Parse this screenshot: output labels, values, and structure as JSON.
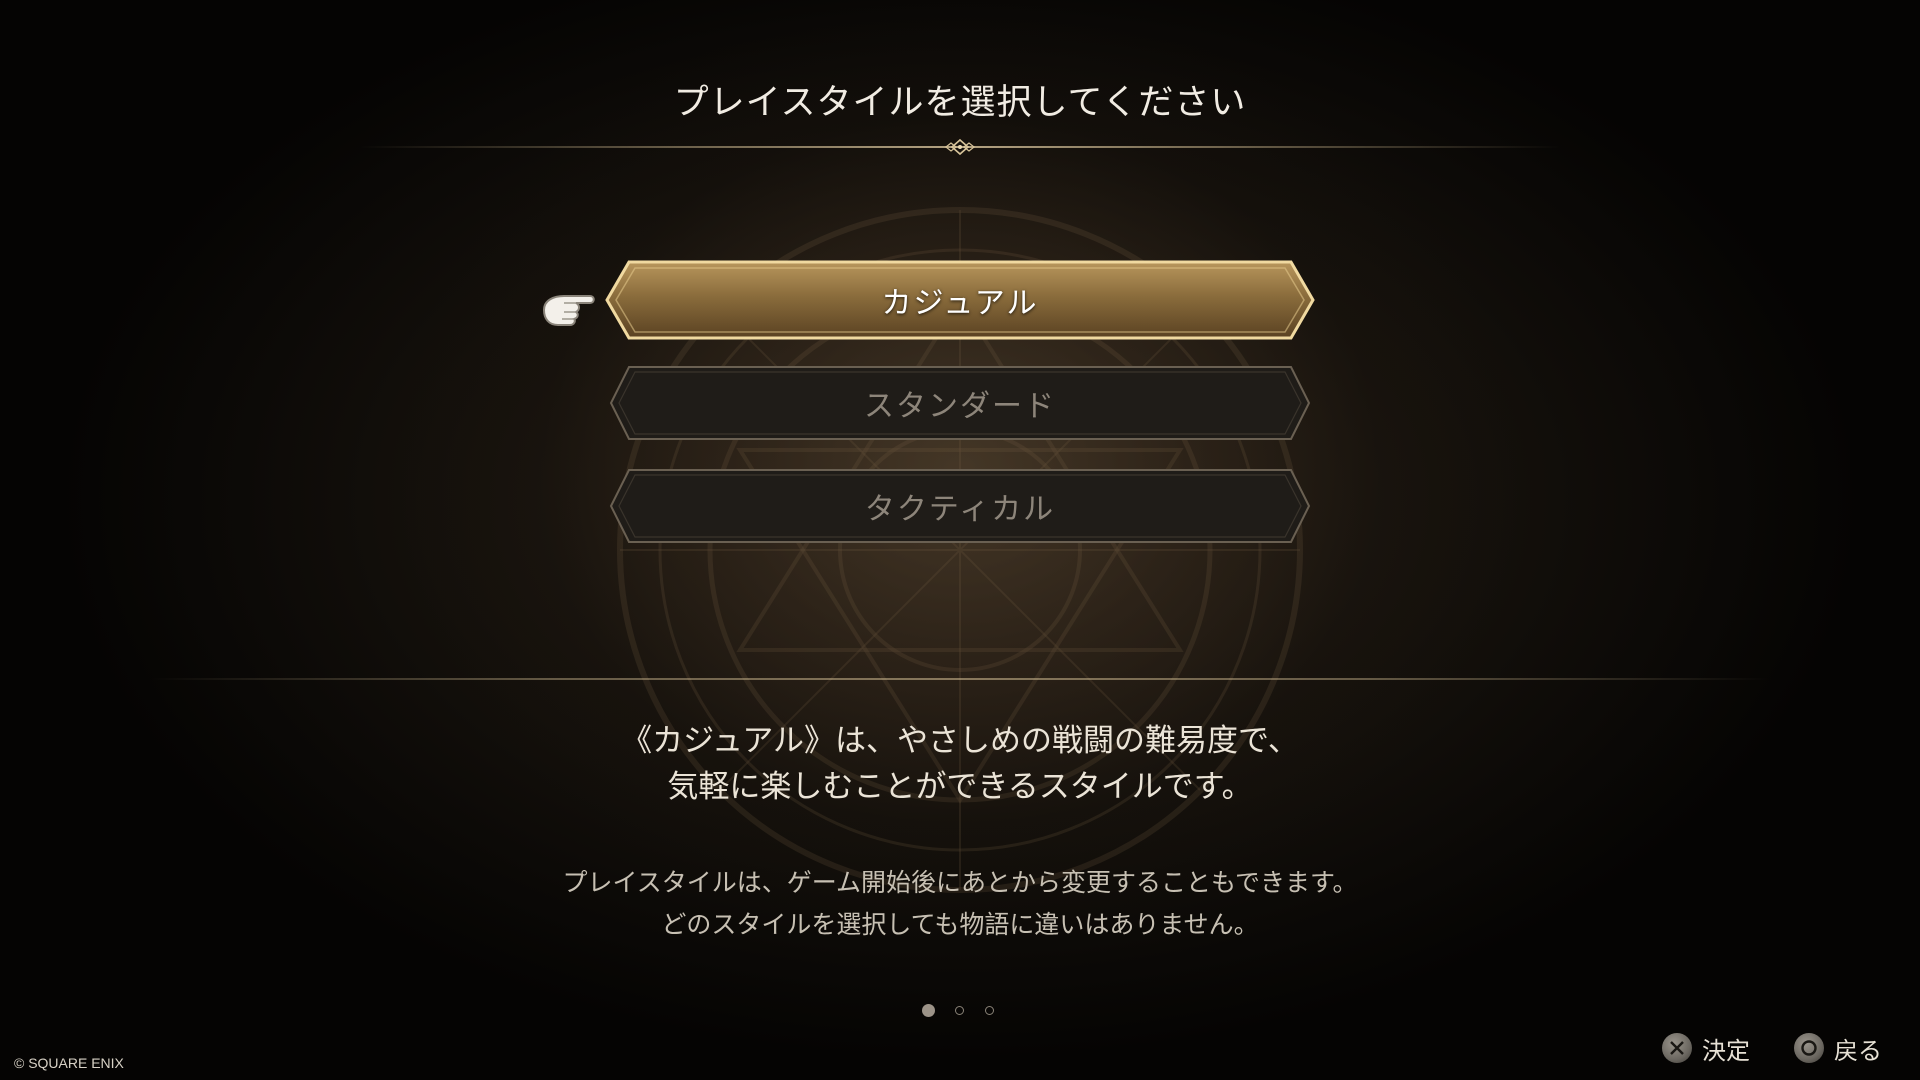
{
  "header": {
    "title": "プレイスタイルを選択してください"
  },
  "options": [
    {
      "label": "カジュアル",
      "selected": true
    },
    {
      "label": "スタンダード",
      "selected": false
    },
    {
      "label": "タクティカル",
      "selected": false
    }
  ],
  "description": {
    "line1": "《カジュアル》は、やさしめの戦闘の難易度で、",
    "line2": "気軽に楽しむことができるスタイルです。"
  },
  "note": {
    "line1": "プレイスタイルは、ゲーム開始後にあとから変更することもできます。",
    "line2": "どのスタイルを選択しても物語に違いはありません。"
  },
  "pagination": {
    "current": 1,
    "total": 3
  },
  "footer": {
    "copyright": "© SQUARE ENIX",
    "confirm_label": "決定",
    "confirm_icon": "cross-button-icon",
    "back_label": "戻る",
    "back_icon": "circle-button-icon"
  },
  "colors": {
    "selected_gold": "#c9a86a",
    "option_dark": "#1f1c18",
    "text_light": "#f1ece3"
  }
}
